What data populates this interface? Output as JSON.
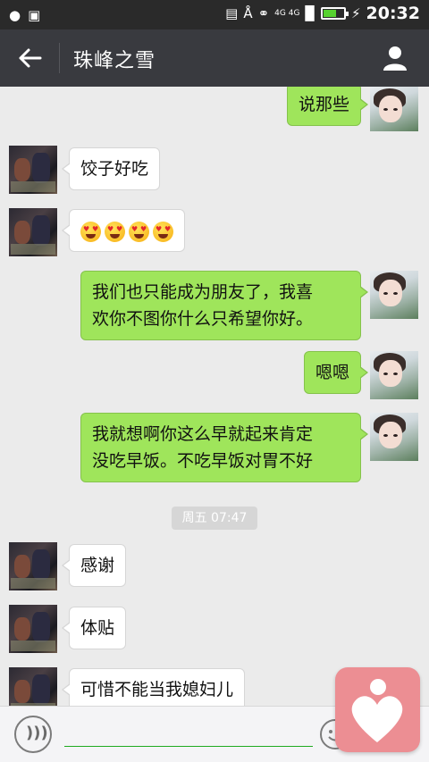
{
  "status_bar": {
    "time": "20:32",
    "network": "4G 4G"
  },
  "header": {
    "title": "珠峰之雪"
  },
  "messages": [
    {
      "from": "me",
      "text": "说那些"
    },
    {
      "from": "contact",
      "text": "饺子好吃"
    },
    {
      "from": "contact",
      "emoji": [
        "smiling-face-with-heart-eyes",
        "smiling-face-with-heart-eyes",
        "smiling-face-with-heart-eyes",
        "smiling-face-with-heart-eyes"
      ]
    },
    {
      "from": "me",
      "lines": [
        "我们也只能成为朋友了，我喜",
        "欢你不图你什么只希望你好。"
      ]
    },
    {
      "from": "me",
      "text": "嗯嗯"
    },
    {
      "from": "me",
      "lines": [
        "我就想啊你这么早就起来肯定",
        "没吃早饭。不吃早饭对胃不好"
      ]
    },
    {
      "from": "contact",
      "text": "感谢"
    },
    {
      "from": "contact",
      "text": "体贴"
    },
    {
      "from": "contact",
      "text": "可惜不能当我媳妇儿"
    }
  ],
  "timestamp": "周五 07:47",
  "colors": {
    "outgoing_bubble": "#9fe55b",
    "header_bg": "#393a3f",
    "chat_bg": "#ebebeb",
    "widget": "#ec8e93"
  },
  "icons": [
    "back-arrow-icon",
    "profile-icon",
    "voice-icon",
    "emoji-icon",
    "heart-widget-icon"
  ]
}
